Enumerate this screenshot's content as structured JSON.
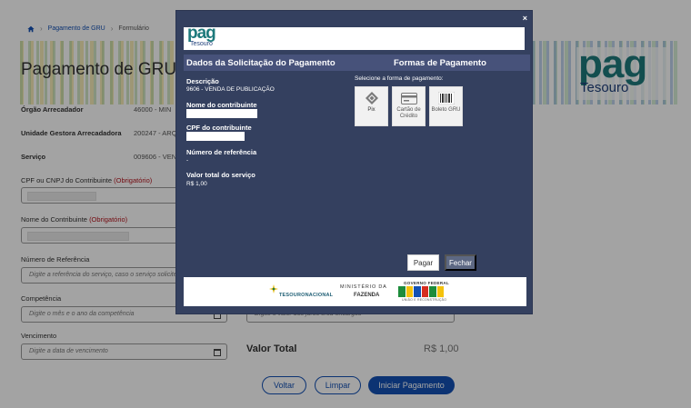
{
  "breadcrumb": {
    "items": [
      "Pagamento de GRU",
      "Formulário"
    ]
  },
  "page": {
    "title": "Pagamento de GRU",
    "info": [
      {
        "label": "Órgão Arrecadador",
        "value": "46000 - MIN"
      },
      {
        "label": "Unidade Gestora Arrecadadora",
        "value": "200247 - ARQ"
      },
      {
        "label": "Serviço",
        "value": "009606 - VEN"
      }
    ],
    "fields": {
      "cpf_label": "CPF ou CNPJ do Contribuinte",
      "cpf_required": "(Obrigatório)",
      "nome_label": "Nome do Contribuinte",
      "nome_required": "(Obrigatório)",
      "ref_label": "Número de Referência",
      "ref_placeholder": "Digite a referência do serviço, caso o serviço solicite",
      "comp_label": "Competência",
      "comp_placeholder": "Digite o mês e o ano da competência",
      "venc_label": "Vencimento",
      "venc_placeholder": "Digite a data de vencimento",
      "right_placeholder": "Digite o valor dos juros e/ou encargos"
    },
    "total_label": "Valor Total",
    "total_value": "R$ 1,00",
    "buttons": {
      "voltar": "Voltar",
      "limpar": "Limpar",
      "iniciar": "Iniciar Pagamento"
    },
    "logo": {
      "pag": "pag",
      "tesouro": "Tesouro"
    }
  },
  "modal": {
    "close": "×",
    "logo": {
      "pag": "pag",
      "tesouro": "Tesouro"
    },
    "header_left": "Dados da Solicitação do Pagamento",
    "header_right": "Formas de Pagamento",
    "descricao_label": "Descrição",
    "descricao_value": "9606 - VENDA DE PUBLICAÇÃO",
    "nome_label": "Nome do contribuinte",
    "cpf_label": "CPF do contribuinte",
    "ref_label": "Número de referência",
    "ref_value": "-",
    "valor_label": "Valor total do serviço",
    "valor_value": "R$  1,00",
    "pay_instruction": "Selecione a forma de pagamento:",
    "pay_options": [
      {
        "label": "Pix",
        "icon": "pix-icon"
      },
      {
        "label": "Cartão de Crédito",
        "icon": "credit-card-icon"
      },
      {
        "label": "Boleto GRU",
        "icon": "barcode-icon"
      }
    ],
    "btn_pagar": "Pagar",
    "btn_fechar": "Fechar",
    "footer": {
      "tesouro_nacional": "TESOURONACIONAL",
      "ministerio_l1": "MINISTÉRIO DA",
      "ministerio_l2": "FAZENDA",
      "gov_federal": "GOVERNO FEDERAL",
      "gov_slogan": "UNIÃO E RECONSTRUÇÃO"
    }
  },
  "colors": {
    "modal_bg": "#34405f",
    "primary": "#1351b4",
    "teal": "#1e7a7c"
  }
}
